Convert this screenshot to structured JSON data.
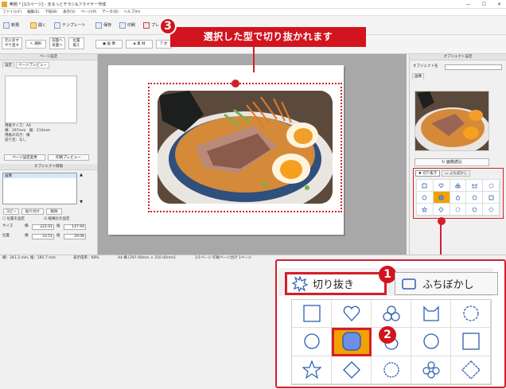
{
  "window": {
    "title": "無題 * [1/1ページ] - まるっとチラシ&フライヤー作成"
  },
  "menu": [
    "ファイル(F)",
    "編集(E)",
    "下揃(B)",
    "表示(V)",
    "ページ(P)",
    "データ(D)",
    "ヘルプ(H)"
  ],
  "toolbar": {
    "new": "新規",
    "open": "開く",
    "template": "テンプレート",
    "save": "保存",
    "print": "印刷",
    "preview": "プレ"
  },
  "toolbar2": {
    "undo": "元に戻す",
    "redo": "やり直す",
    "select": "選択",
    "front": "前面へ",
    "back": "背面へ",
    "align": "位置",
    "align2": "揃え",
    "image": "画 像",
    "material": "素 材",
    "text": "文"
  },
  "left_panel": {
    "title": "ページ設定",
    "tab_settings": "設定",
    "tab_preview": "ページプレビュー",
    "paper_size": "用紙サイズ：A4",
    "paper_dims": "横：297mm　縦：210mm",
    "orientation": "用紙の向き：横",
    "fold": "途り足：なし",
    "btn_page_settings": "ページ設定変更",
    "btn_print_preview": "印刷プレビュー"
  },
  "object_info": {
    "title": "オブジェクト情報",
    "list_item": "画像",
    "btn_copy": "コピー",
    "btn_paste": "貼り付け",
    "btn_delete": "削除",
    "chk_position": "位置を固定",
    "chk_aspect": "縦横比を固定",
    "size_label": "サイズ",
    "pos_label": "位置",
    "w_label": "横",
    "h_label": "縦",
    "size_w": "222.01",
    "size_h": "147.94",
    "pos_x": "33.51",
    "pos_y": "29.06"
  },
  "right_panel": {
    "title": "オブジェクト設定",
    "name_label": "オブジェクト名",
    "tab_image": "画像",
    "btn_load_image": "画像読込",
    "tab_cutout": "切り抜き",
    "tab_fade": "ふちぼかし"
  },
  "status": {
    "coords": "横：341.3 mm, 縦：185.7 mm",
    "zoom": "表示倍率：68%",
    "paper": "A4 横 [297.00mm × 210.00mm]",
    "page": "1/1ページ 印刷ページ合計 1ページ"
  },
  "callout": {
    "text": "選択した型で切り抜かれます",
    "n1": "1",
    "n2": "2",
    "n3": "3"
  },
  "zoom_panel": {
    "tab_cutout": "切り抜き",
    "tab_fade": "ふちぼかし"
  },
  "colors": {
    "accent": "#d2141f",
    "selected_shape": "#f2a200",
    "shape_blue": "#2d5fb0"
  }
}
